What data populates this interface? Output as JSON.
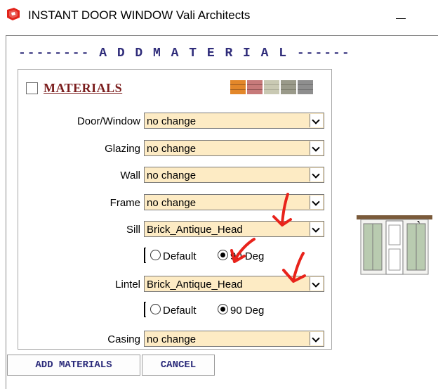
{
  "window": {
    "title": "INSTANT DOOR WINDOW  Vali Architects",
    "minimize_label": "—"
  },
  "form": {
    "heading": "-------- A D D   M A T E R I A L ------",
    "materials_label": "MATERIALS",
    "materials_checked": false,
    "fields": [
      {
        "label": "Door/Window",
        "value": "no change"
      },
      {
        "label": "Glazing",
        "value": "no change"
      },
      {
        "label": "Wall",
        "value": "no change"
      },
      {
        "label": "Frame",
        "value": "no change"
      },
      {
        "label": "Sill",
        "value": "Brick_Antique_Head"
      },
      {
        "label": "Lintel",
        "value": "Brick_Antique_Head"
      },
      {
        "label": "Casing",
        "value": "no change"
      }
    ],
    "sill_options": {
      "default_label": "Default",
      "deg_label": "90 Deg",
      "selected": "90 Deg"
    },
    "lintel_options": {
      "default_label": "Default",
      "deg_label": "90 Deg",
      "selected": "90 Deg"
    },
    "buttons": {
      "add": "ADD MATERIALS",
      "cancel": "CANCEL"
    }
  },
  "colors": {
    "select_bg": "#fdebc4",
    "heading": "#2f2c7a",
    "materials_label": "#7a1c1c",
    "annotation": "#e8231b"
  },
  "icons": [
    "sketchup-app-icon",
    "chevron-down-icon",
    "material-swatches-icon",
    "door-window-preview-icon"
  ]
}
